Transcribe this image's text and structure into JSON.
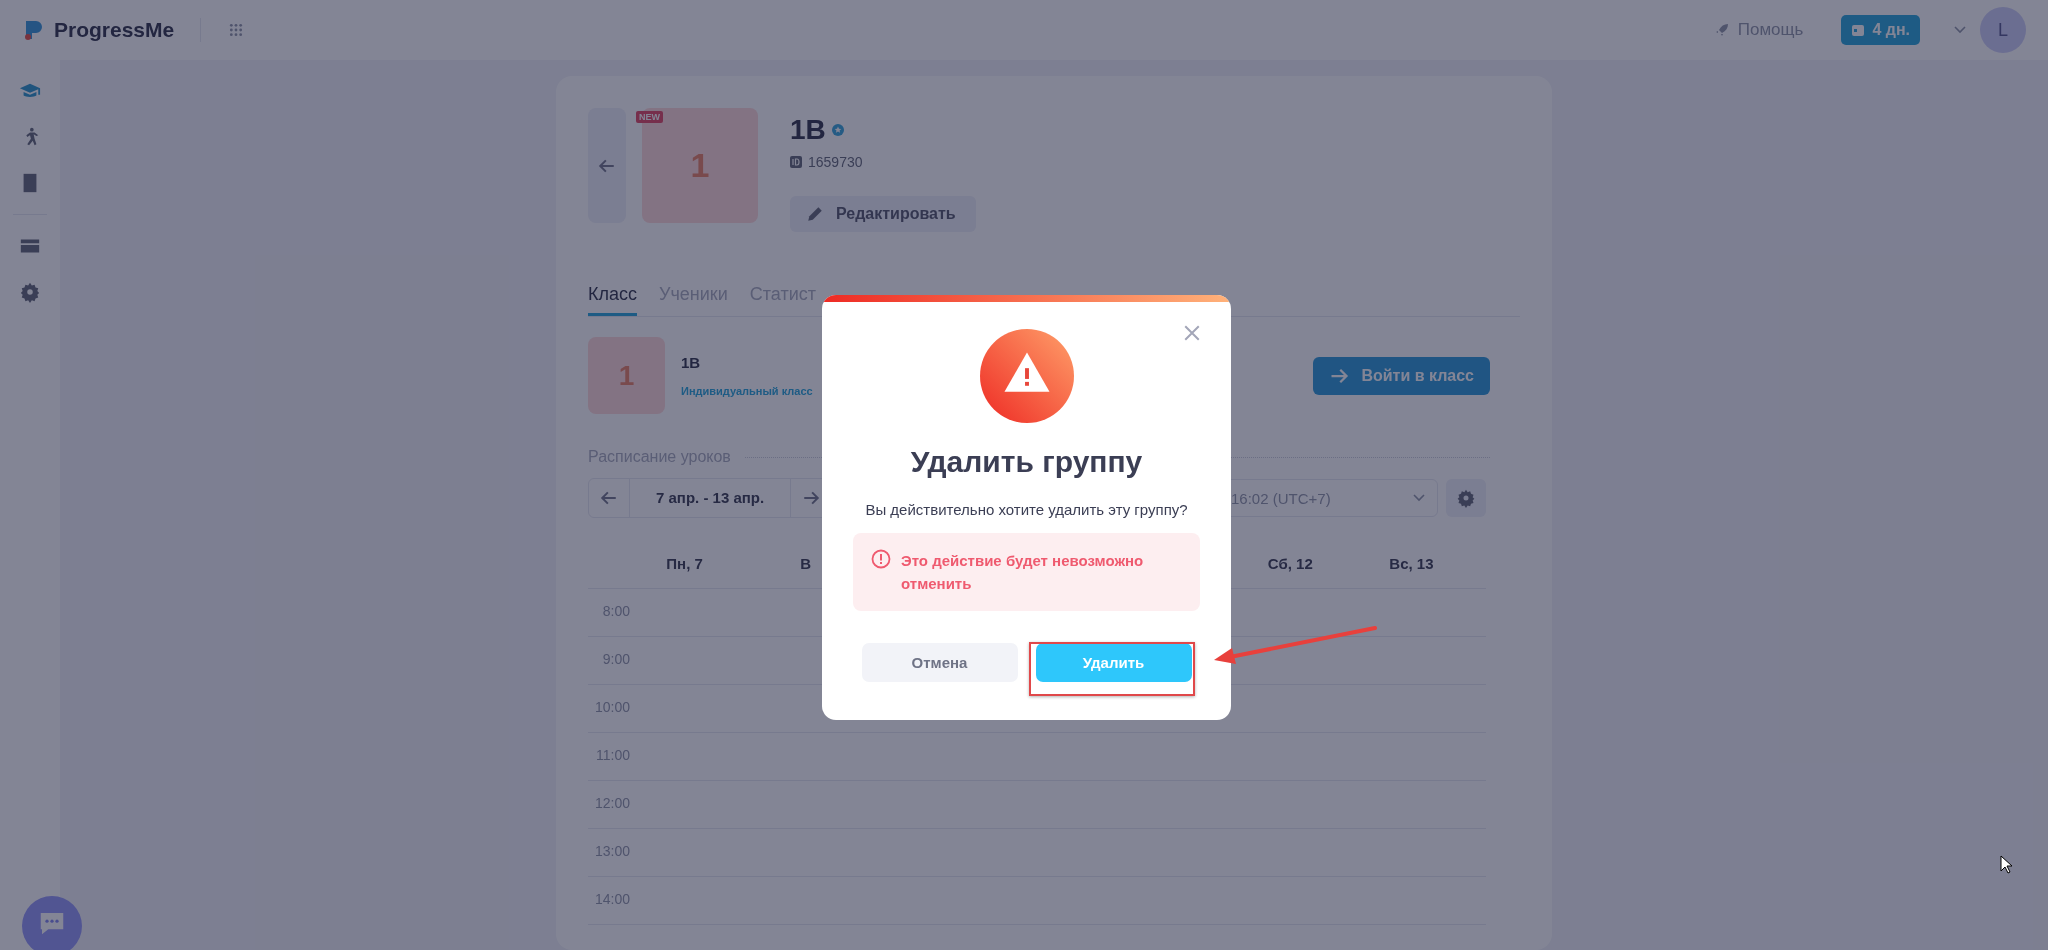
{
  "topbar": {
    "logo": "ProgressMe",
    "help": "Помощь",
    "trial_badge": "4 дн.",
    "avatar": "L"
  },
  "sidebar": {
    "items": [
      {
        "selected": true
      },
      {
        "selected": false
      },
      {
        "selected": false
      },
      {
        "selected": false
      },
      {
        "selected": false
      }
    ]
  },
  "group": {
    "tile": "1",
    "badge": "NEW",
    "title": "1В",
    "id": "1659730",
    "edit": "Редактировать"
  },
  "tabs": [
    {
      "label": "Класс",
      "selected": true
    },
    {
      "label": "Ученики",
      "selected": false
    },
    {
      "label": "Статист",
      "selected": false
    }
  ],
  "class_row": {
    "tile": "1",
    "name": "1В",
    "type": "Индивидуальный класс",
    "enter": "Войти в класс"
  },
  "schedule": {
    "title": "Расписание уроков",
    "week": "7 апр. - 13 апр.",
    "timezone": "16:02 (UTC+7)",
    "days_start": [
      "Пн, 7",
      "В"
    ],
    "days_end": [
      "Сб, 12",
      "Вс, 13"
    ],
    "times": [
      "8:00",
      "9:00",
      "10:00",
      "11:00",
      "12:00",
      "13:00",
      "14:00"
    ]
  },
  "dialog": {
    "title": "Удалить группу",
    "message": "Вы действительно хотите удалить эту группу?",
    "warning": "Это действие будет невозможно отменить",
    "buttons": [
      {
        "label": "Отмена",
        "kind": "secondary"
      },
      {
        "label": "Удалить",
        "kind": "primary"
      }
    ]
  }
}
